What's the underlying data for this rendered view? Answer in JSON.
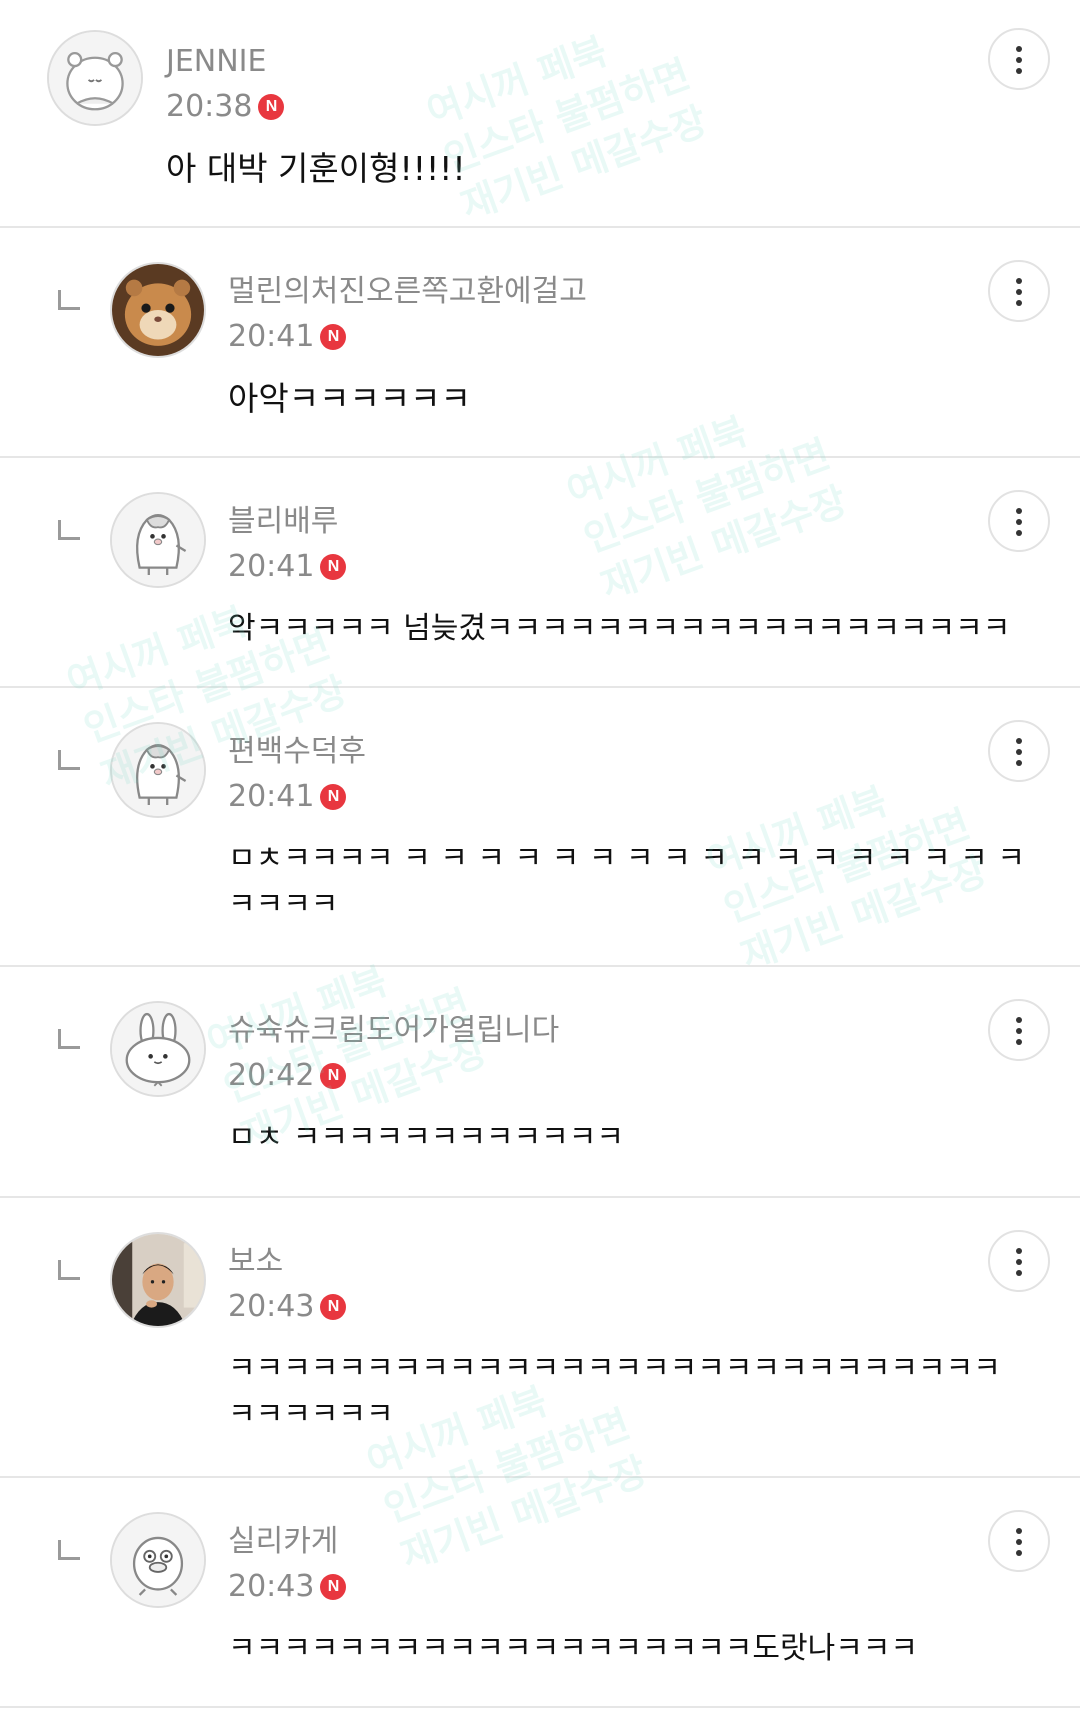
{
  "comments": [
    {
      "nickname": "JENNIE",
      "time": "20:38",
      "badge": "N",
      "text": "아 대박 기훈이형!!!!!",
      "is_reply": false,
      "avatar": "hamster-character"
    },
    {
      "nickname": "멀린의처진오른쪽고환에걸고",
      "time": "20:41",
      "badge": "N",
      "text": "아악ㅋㅋㅋㅋㅋㅋ",
      "is_reply": true,
      "avatar": "hamster-photo"
    },
    {
      "nickname": "블리배루",
      "time": "20:41",
      "badge": "N",
      "text": "악ㅋㅋㅋㅋㅋ 넘늦겼ㅋㅋㅋㅋㅋㅋㅋㅋㅋㅋㅋㅋㅋㅋㅋㅋㅋㅋㅋ",
      "is_reply": true,
      "avatar": "penguin-character"
    },
    {
      "nickname": "편백수덕후",
      "time": "20:41",
      "badge": "N",
      "text": "ㅁㅊㅋㅋㅋㅋ ㅋ ㅋ ㅋ ㅋ ㅋ ㅋ ㅋ ㅋ ㅋ ㅋ ㅋ ㅋ ㅋ ㅋ ㅋ ㅋ ㅋ ㅋㅋㅋㅋ",
      "is_reply": true,
      "avatar": "penguin-character"
    },
    {
      "nickname": "슈슉슈크림도어가열립니다",
      "time": "20:42",
      "badge": "N",
      "text": "ㅁㅊ ㅋㅋㅋㅋㅋㅋㅋㅋㅋㅋㅋㅋ",
      "is_reply": true,
      "avatar": "rabbit-character"
    },
    {
      "nickname": "보소",
      "time": "20:43",
      "badge": "N",
      "text": "ㅋㅋㅋㅋㅋㅋㅋㅋㅋㅋㅋㅋㅋㅋㅋㅋㅋㅋㅋㅋㅋㅋㅋㅋㅋㅋㅋㅋㅋㅋㅋㅋㅋㅋ",
      "is_reply": true,
      "avatar": "person-photo"
    },
    {
      "nickname": "실리카게",
      "time": "20:43",
      "badge": "N",
      "text": "ㅋㅋㅋㅋㅋㅋㅋㅋㅋㅋㅋㅋㅋㅋㅋㅋㅋㅋㅋ도랏나ㅋㅋㅋ",
      "is_reply": true,
      "avatar": "duck-character"
    }
  ],
  "watermark": {
    "line1": "여시꺼 페북",
    "line2": "인스타 불펌하면",
    "line3": "재기빈 메갈수장"
  },
  "icons": {
    "more": "more-vertical-icon",
    "reply": "reply-arrow-icon",
    "badge": "new-badge-icon"
  },
  "colors": {
    "badge": "#e8373f",
    "nickname": "#8a8a8a",
    "divider": "#e6e6e6",
    "watermark": "#78d7c8"
  }
}
